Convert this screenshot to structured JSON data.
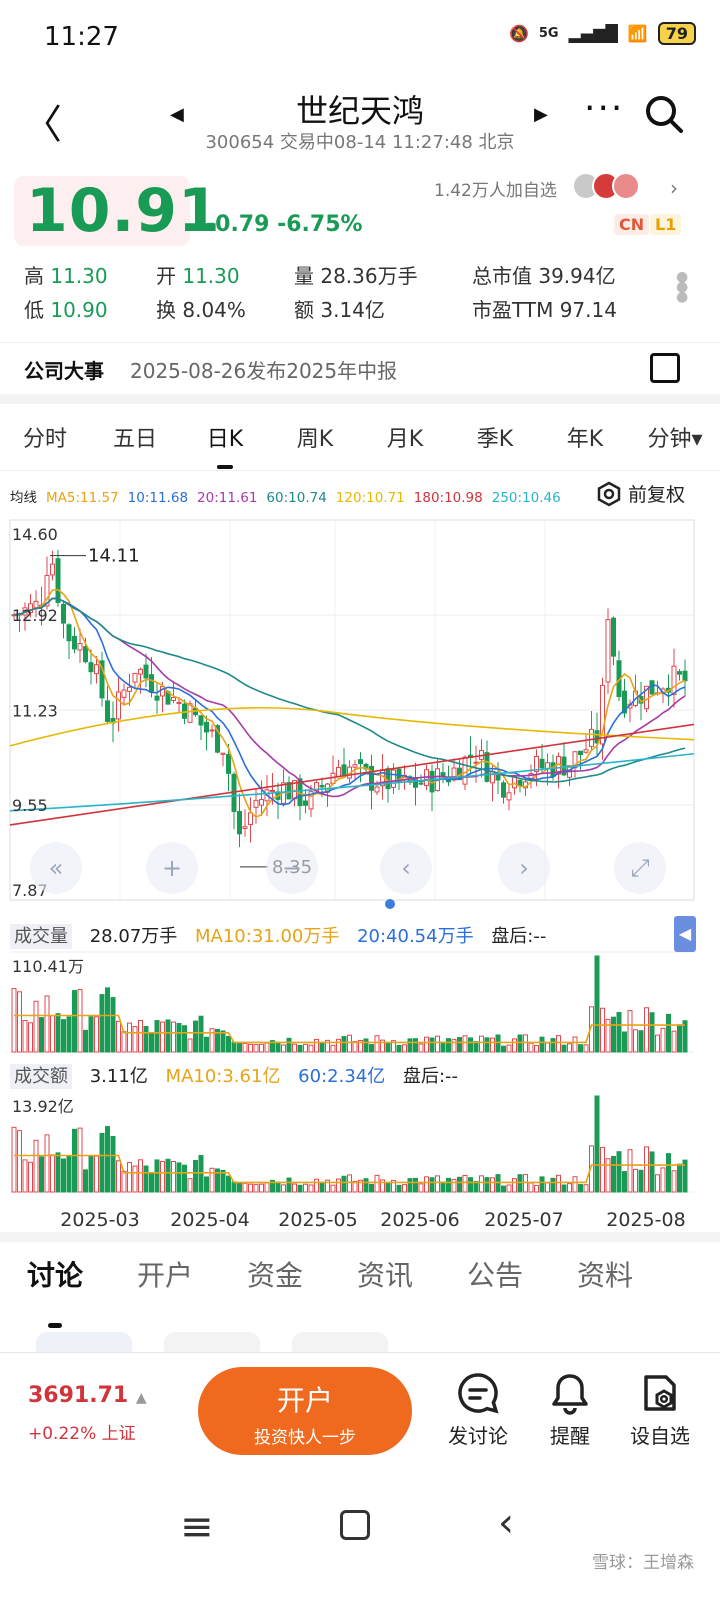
{
  "status": {
    "time": "11:27",
    "network": "5G",
    "battery": "79"
  },
  "header": {
    "title": "世纪天鸿",
    "subtitle": "300654 交易中08-14 11:27:48 北京"
  },
  "quote": {
    "price": "10.91",
    "change": "-0.79",
    "change_pct": "-6.75%",
    "followers": "1.42万人加自选",
    "tag_cn": "CN",
    "tag_l1": "L1",
    "fields": [
      {
        "k": "高",
        "v": "11.30"
      },
      {
        "k": "开",
        "v": "11.30"
      },
      {
        "k": "量",
        "v": "28.36万手"
      },
      {
        "k": "总市值",
        "v": "39.94亿"
      },
      {
        "k": "低",
        "v": "10.90"
      },
      {
        "k": "换",
        "v": "8.04%"
      },
      {
        "k": "额",
        "v": "3.14亿"
      },
      {
        "k": "市盈TTM",
        "v": "97.14"
      }
    ]
  },
  "event": {
    "label": "公司大事",
    "text": "2025-08-26发布2025年中报"
  },
  "period_tabs": [
    "分时",
    "五日",
    "日K",
    "周K",
    "月K",
    "季K",
    "年K",
    "分钟▾"
  ],
  "active_period": "日K",
  "ma_legend": [
    {
      "label": "均线",
      "color": "#222222"
    },
    {
      "label": "MA5:11.57",
      "color": "#e8a317"
    },
    {
      "label": "10:11.68",
      "color": "#2a6fdb"
    },
    {
      "label": "20:11.61",
      "color": "#a83aa8"
    },
    {
      "label": "60:10.74",
      "color": "#1f8a8a"
    },
    {
      "label": "120:10.71",
      "color": "#e6b800"
    },
    {
      "label": "180:10.98",
      "color": "#d2343c"
    },
    {
      "label": "250:10.46",
      "color": "#28b4c8"
    }
  ],
  "adjust_label": "前复权",
  "chart_data": {
    "type": "candlestick",
    "y_ticks": [
      "14.60",
      "12.92",
      "11.23",
      "9.55",
      "7.87"
    ],
    "ylim": [
      7.87,
      14.6
    ],
    "high_marker": "14.11",
    "low_marker": "8.35",
    "x_ticks": [
      "2025-03",
      "2025-04",
      "2025-05",
      "2025-06",
      "2025-07",
      "2025-08"
    ],
    "volume": {
      "label": "成交量",
      "value": "28.07万手",
      "ma10": "MA10:31.00万手",
      "ma20": "20:40.54万手",
      "after": "盘后:--",
      "max": "110.41万"
    },
    "amount": {
      "label": "成交额",
      "value": "3.11亿",
      "ma10": "MA10:3.61亿",
      "ma60": "60:2.34亿",
      "after": "盘后:--",
      "max": "13.92亿"
    }
  },
  "bottom_tabs": [
    "讨论",
    "开户",
    "资金",
    "资讯",
    "公告",
    "资料"
  ],
  "index": {
    "value": "3691.71",
    "change": "+0.22% 上证"
  },
  "open_account": {
    "title": "开户",
    "sub": "投资快人一步"
  },
  "actions": [
    "发讨论",
    "提醒",
    "设自选"
  ],
  "watermark": "雪球：王增森"
}
